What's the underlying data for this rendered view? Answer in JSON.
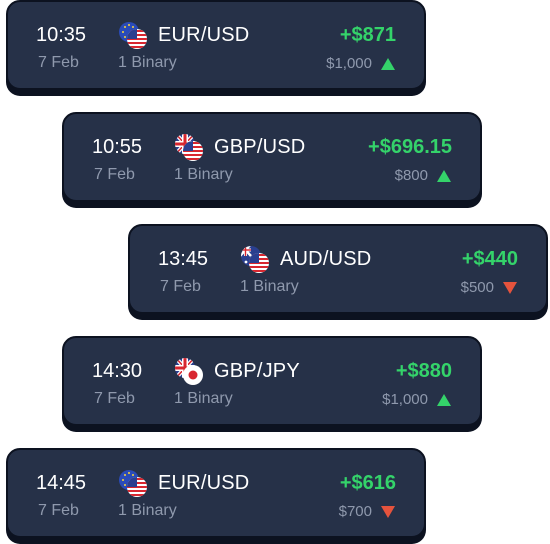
{
  "trades": [
    {
      "time": "10:35",
      "date": "7 Feb",
      "pair": "EUR/USD",
      "type": "1 Binary",
      "profit": "+$871",
      "stake": "$1,000",
      "direction": "up",
      "flag_icons": [
        "eu-flag-icon",
        "us-flag-icon"
      ]
    },
    {
      "time": "10:55",
      "date": "7 Feb",
      "pair": "GBP/USD",
      "type": "1 Binary",
      "profit": "+$696.15",
      "stake": "$800",
      "direction": "up",
      "flag_icons": [
        "uk-flag-icon",
        "us-flag-icon"
      ]
    },
    {
      "time": "13:45",
      "date": "7 Feb",
      "pair": "AUD/USD",
      "type": "1 Binary",
      "profit": "+$440",
      "stake": "$500",
      "direction": "down",
      "flag_icons": [
        "au-flag-icon",
        "us-flag-icon"
      ]
    },
    {
      "time": "14:30",
      "date": "7 Feb",
      "pair": "GBP/JPY",
      "type": "1 Binary",
      "profit": "+$880",
      "stake": "$1,000",
      "direction": "up",
      "flag_icons": [
        "uk-flag-icon",
        "jp-flag-icon"
      ]
    },
    {
      "time": "14:45",
      "date": "7 Feb",
      "pair": "EUR/USD",
      "type": "1 Binary",
      "profit": "+$616",
      "stake": "$700",
      "direction": "down",
      "flag_icons": [
        "eu-flag-icon",
        "us-flag-icon"
      ]
    }
  ],
  "colors": {
    "card": "#263148",
    "profit": "#34d36a",
    "up": "#34d36a",
    "down": "#e5533d",
    "muted": "#8f99ad"
  }
}
